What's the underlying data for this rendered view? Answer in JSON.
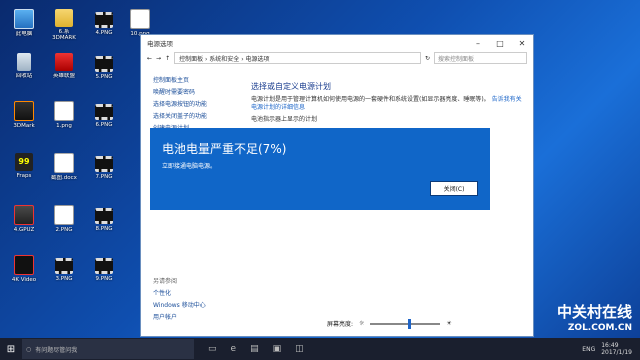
{
  "desktop": {
    "icons": [
      {
        "label": "此电脑",
        "kind": "pc",
        "icon": "computer-icon"
      },
      {
        "label": "6.系\n3DMARK",
        "kind": "folder",
        "icon": "folder-icon"
      },
      {
        "label": "4.PNG",
        "kind": "film",
        "icon": "image-file-icon"
      },
      {
        "label": "10.png",
        "kind": "png",
        "icon": "image-file-icon"
      },
      {
        "label": "回收站",
        "kind": "bin",
        "icon": "recycle-bin-icon"
      },
      {
        "label": "英雄联盟",
        "kind": "app-red",
        "icon": "game-icon"
      },
      {
        "label": "5.PNG",
        "kind": "film",
        "icon": "image-file-icon"
      },
      {
        "label": "3DMark",
        "kind": "app-dark",
        "icon": "3dmark-icon"
      },
      {
        "label": "1.png",
        "kind": "png",
        "icon": "image-file-icon"
      },
      {
        "label": "6.PNG",
        "kind": "film",
        "icon": "image-file-icon"
      },
      {
        "label": "Fraps",
        "kind": "fraps",
        "icon": "fraps-icon"
      },
      {
        "label": "截图.docx",
        "kind": "word",
        "icon": "word-document-icon"
      },
      {
        "label": "7.PNG",
        "kind": "film",
        "icon": "image-file-icon"
      },
      {
        "label": "4.GPUZ",
        "kind": "gpuz",
        "icon": "gpuz-icon"
      },
      {
        "label": "2.PNG",
        "kind": "png",
        "icon": "image-file-icon"
      },
      {
        "label": "8.PNG",
        "kind": "film",
        "icon": "image-file-icon"
      },
      {
        "label": "4K Video",
        "kind": "logo",
        "icon": "video-app-icon"
      },
      {
        "label": "3.PNG",
        "kind": "film",
        "icon": "image-file-icon"
      },
      {
        "label": "9.PNG",
        "kind": "film",
        "icon": "image-file-icon"
      }
    ]
  },
  "window": {
    "title": "电源选项",
    "breadcrumb": "控制面板 › 系统和安全 › 电源选项",
    "search_placeholder": "搜索控制面板",
    "sidebar": [
      "控制面板主页",
      "唤醒时需要密码",
      "选择电源按钮的功能",
      "选择关闭盖子的功能",
      "创建电源计划"
    ],
    "sidebar_bottom_header": "另请参阅",
    "sidebar_bottom": [
      "个性化",
      "Windows 移动中心",
      "用户帐户"
    ],
    "heading": "选择或自定义电源计划",
    "description": "电源计划是用于管理计算机如何使用电源的一套硬件和系统设置(如显示器亮度、睡眠等)。",
    "link": "告诉我有关电源计划的详细信息",
    "plans_header": "电池指示器上显示的计划",
    "change_plan": "更改计划设置",
    "brightness_label": "屏幕亮度:"
  },
  "toast": {
    "title": "电池电量严重不足(7%)",
    "subtitle": "立即接通电脑电源。",
    "button": "关闭(C)"
  },
  "taskbar": {
    "search_placeholder": "有问题尽管问我",
    "time": "16:49",
    "date": "2017/1/19",
    "lang": "ENG"
  },
  "watermark": {
    "brand": "中关村在线",
    "url": "ZOL.COM.CN"
  }
}
